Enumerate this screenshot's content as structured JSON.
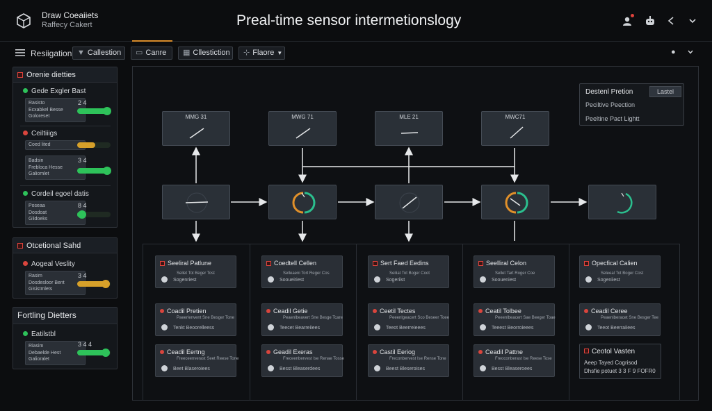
{
  "header": {
    "app_name": "Draw Coeaiiets",
    "app_subtitle": "Raffecy Cakert",
    "title": "Preal-time sensor intermetionslogy",
    "icons": [
      "user-alert-icon",
      "robot-icon",
      "share-icon",
      "chevron-down-icon"
    ]
  },
  "toolbar": {
    "nav_label": "Resiigation",
    "buttons": [
      {
        "icon": "filter-icon",
        "label": "Callestion"
      },
      {
        "icon": "folder-icon",
        "label": "Canre"
      },
      {
        "icon": "grid-icon",
        "label": "Cllestiction"
      },
      {
        "icon": "pin-icon",
        "label": "Flaore"
      }
    ],
    "right_icons": [
      "bulb-icon",
      "chevron-down-icon"
    ]
  },
  "sidebar": {
    "panel1": {
      "title": "Orenie dietties",
      "sections": [
        {
          "title": "Gede Exgler Bast",
          "status": "green",
          "card_title": "Rasisto",
          "card_lines": [
            "Ecxabkel Besse",
            "Goloreset"
          ],
          "value": "2 4",
          "level": 0.9,
          "color": "#2ec25a"
        },
        {
          "title": "Ceiltiiigs",
          "status": "red",
          "card_title": "Coed lited",
          "card_lines": [],
          "value": "",
          "level": 0.55,
          "color": "#d6a02a"
        },
        {
          "title": "",
          "status": "",
          "card_title": "Badsin",
          "card_lines": [
            "Frebloca Hesse",
            "Galiomlet"
          ],
          "value": "3 4",
          "level": 0.9,
          "color": "#2ec25a"
        },
        {
          "title": "Cordeil egoel datis",
          "status": "green",
          "card_title": "Poseaa",
          "card_lines": [
            "Dosdoat",
            "Glidoeks"
          ],
          "value": "8 4",
          "level": 0.15,
          "color": "#2ec25a"
        }
      ]
    },
    "panel2": {
      "title": "Otcetional Sahd",
      "sections": [
        {
          "title": "Aogeal Veslity",
          "status": "red",
          "card_title": "Rasim",
          "card_lines": [
            "Dosdesloor Bent",
            "Gisistmlets"
          ],
          "value": "3 4",
          "level": 0.85,
          "color": "#d6a02a"
        }
      ]
    },
    "panel3": {
      "title": "Fortling Dietters",
      "sections": [
        {
          "title": "Eatilstbl",
          "status": "green",
          "card_title": "Riasim",
          "card_lines": [
            "Debaelde Hest",
            "Galioralet"
          ],
          "value": "3 4 4",
          "level": 0.85,
          "color": "#2ec25a"
        }
      ]
    }
  },
  "legend": {
    "title": "Destenl Pretion",
    "button": "Lastel",
    "items": [
      "Peciltive Peection",
      "Peeltine Pact Lightt"
    ]
  },
  "diagram": {
    "top_nodes": [
      "MMG 31",
      "MWG 71",
      "MLE 21",
      "MWC71"
    ],
    "mid_nodes": [
      "",
      "",
      "",
      "",
      ""
    ],
    "columns": [
      {
        "cards": [
          {
            "title": "Seeliral Patlune",
            "sub_top": "Sellet Tot Beger Tost",
            "sub_bottom": "Sogenriest"
          },
          {
            "title": "Coadil Pretien",
            "sub_top": "Paeerlenvent Sne Besger Tone",
            "sub_bottom": "Tenkt Beoorelleess"
          },
          {
            "title": "Ceadil Eertng",
            "sub_top": "Freeceenverast Seet Reese Tone",
            "sub_bottom": "Beet Blaseroiees"
          }
        ]
      },
      {
        "cards": [
          {
            "title": "Coedtell Cellen",
            "sub_top": "Selleaeni Tort Reger Cos",
            "sub_bottom": "Sooueiriest"
          },
          {
            "title": "Ceadil Getie",
            "sub_top": "Peaenlbeavert Sne Besge Tcare",
            "sub_bottom": "Teecet Bearreiiees"
          },
          {
            "title": "Geadil Exeras",
            "sub_top": "Freceenbervest Ise Renae Tosse",
            "sub_bottom": "Besst Bleaserdees"
          }
        ]
      },
      {
        "cards": [
          {
            "title": "Sert Faed Eedins",
            "sub_top": "Seiliat Tot Boger Coot",
            "sub_bottom": "Sogeriist"
          },
          {
            "title": "Ceetil Tectes",
            "sub_top": "Peeenlgeacert Sco Beseer Toee",
            "sub_bottom": "Teeot Beerreieees"
          },
          {
            "title": "Castil Eeriog",
            "sub_top": "Freconbervest Ise Rense Tone",
            "sub_bottom": "Beest Bleseroises"
          }
        ]
      },
      {
        "cards": [
          {
            "title": "Seelliral Celon",
            "sub_top": "Sellet Tart Roger Coe",
            "sub_bottom": "Sooueniest"
          },
          {
            "title": "Ceatil Tolbee",
            "sub_top": "Peeenlbeacert Sae Beeger Toae",
            "sub_bottom": "Teeest Beorroieees"
          },
          {
            "title": "Ceadil Pattne",
            "sub_top": "Freoconberast Ise Reese Tose",
            "sub_bottom": "Besst Bleaseroees"
          }
        ]
      },
      {
        "cards": [
          {
            "title": "Opecfical Calien",
            "sub_top": "Seleeal Tot Boger Cost",
            "sub_bottom": "Sogeniiest"
          },
          {
            "title": "Ceadil Ceree",
            "sub_top": "Peaeniberacet Sne Besger Tee",
            "sub_bottom": "Teeot Beerraiiees"
          }
        ]
      }
    ],
    "summary": {
      "title": "Ceotol Vasten",
      "lines": [
        "Aeep Tayed Cogrisod",
        "Dhsfie potuet 3 3 F 9 FOFR0"
      ]
    }
  },
  "colors": {
    "accent": "#d98c2b",
    "ok": "#2ec25a",
    "alert": "#e0433c",
    "warn": "#d6a02a",
    "node": "#2a3037"
  }
}
